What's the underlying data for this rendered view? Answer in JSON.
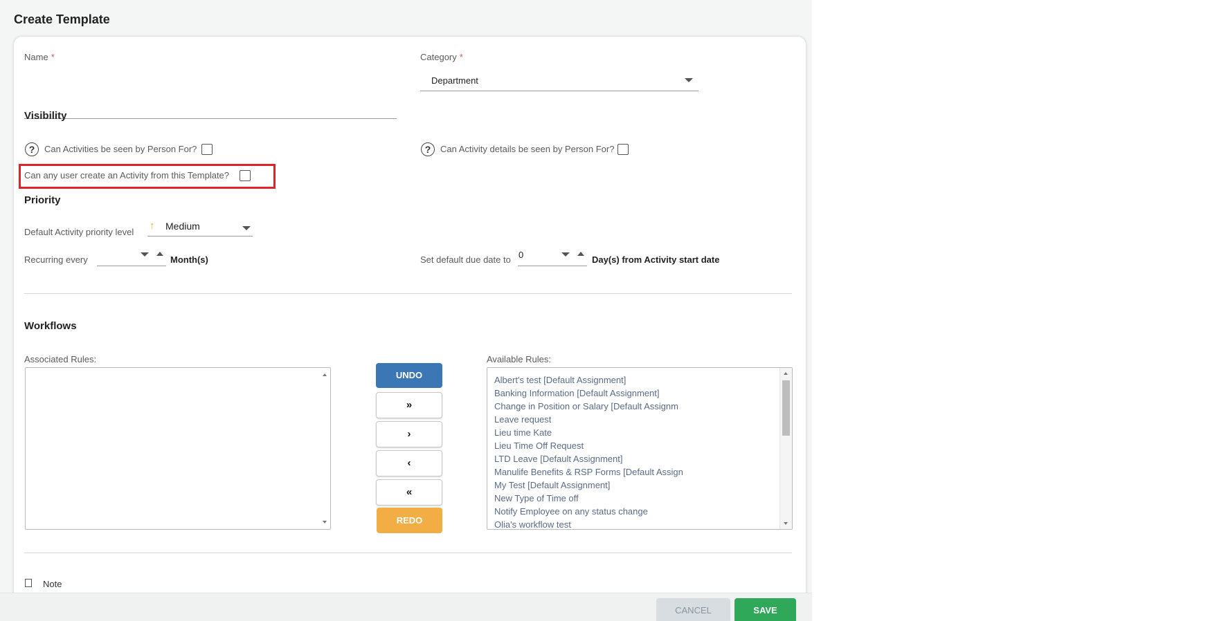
{
  "page": {
    "title": "Create Template"
  },
  "form": {
    "name_label": "Name",
    "required_mark": "*",
    "name_value": "",
    "category_label": "Category",
    "category_value": "Department"
  },
  "visibility": {
    "title": "Visibility",
    "seen_by_person_label": "Can Activities be seen by Person For?",
    "details_by_person_label": "Can Activity details be seen by Person For?",
    "any_user_create_label": "Can any user create an Activity from this Template?",
    "help_glyph": "?"
  },
  "priority": {
    "title": "Priority",
    "default_level_label": "Default Activity priority level",
    "level_value": "Medium",
    "level_icon": "arrow-up-icon",
    "level_color": "#f2a531",
    "recurring_label": "Recurring every",
    "recurring_value": "",
    "recurring_unit": "Month(s)",
    "due_date_label": "Set default due date to",
    "due_date_value": "0",
    "due_date_unit": "Day(s) from Activity start date"
  },
  "workflows": {
    "title": "Workflows",
    "associated_label": "Associated Rules:",
    "available_label": "Available Rules:",
    "associated_rules": [],
    "available_rules": [
      "Albert's test [Default Assignment]",
      "Banking Information [Default Assignment]",
      "Change in Position or Salary [Default Assignm",
      "Leave request",
      "Lieu time Kate",
      "Lieu Time Off Request",
      "LTD Leave [Default Assignment]",
      "Manulife Benefits & RSP Forms [Default Assign",
      "My Test [Default Assignment]",
      "New Type of Time off",
      "Notify Employee on any status change",
      "Olia's workflow test"
    ],
    "buttons": {
      "undo": "UNDO",
      "move_all_right": "»",
      "move_right": "›",
      "move_left": "‹",
      "move_all_left": "«",
      "redo": "REDO"
    }
  },
  "note": {
    "label": "Note"
  },
  "footer": {
    "cancel": "CANCEL",
    "save": "SAVE"
  },
  "colors": {
    "undo": "#3c77b5",
    "redo": "#f2ad45",
    "save": "#2fa85a",
    "highlight": "#e0232b"
  }
}
